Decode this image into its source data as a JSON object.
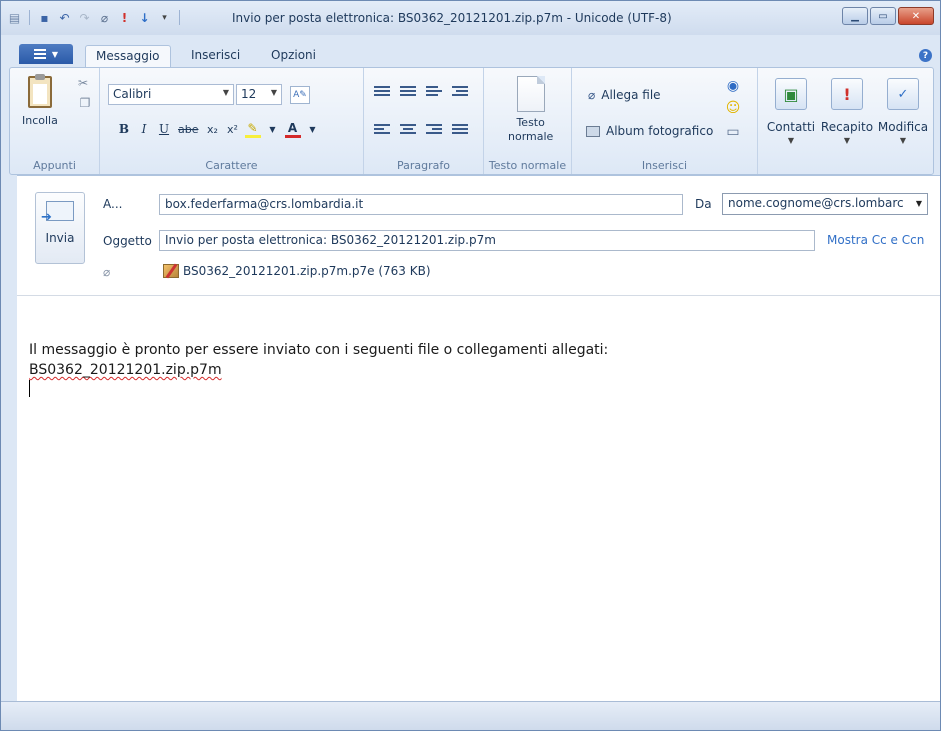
{
  "window": {
    "title": "Invio per posta elettronica: BS0362_20121201.zip.p7m - Unicode (UTF-8)"
  },
  "quick_access": {
    "icons": [
      "new-icon",
      "save-icon",
      "undo-icon",
      "redo-icon",
      "attach-icon",
      "high-importance-icon",
      "low-importance-icon",
      "customize-icon"
    ]
  },
  "tabs": [
    {
      "label": "Messaggio",
      "active": true
    },
    {
      "label": "Inserisci",
      "active": false
    },
    {
      "label": "Opzioni",
      "active": false
    }
  ],
  "ribbon": {
    "appunti": {
      "label": "Appunti",
      "paste_label": "Incolla"
    },
    "carattere": {
      "label": "Carattere",
      "font_name": "Calibri",
      "font_size": "12",
      "bold": "B",
      "italic": "I",
      "underline": "U",
      "strike": "abe",
      "subscript": "x₂",
      "superscript": "x²",
      "font_color": "A"
    },
    "paragrafo": {
      "label": "Paragrafo"
    },
    "testo_normale": {
      "label": "Testo normale",
      "button_line1": "Testo",
      "button_line2": "normale"
    },
    "inserisci": {
      "label": "Inserisci",
      "attach_file": "Allega file",
      "photo_album": "Album fotografico"
    },
    "actions": [
      {
        "label": "Contatti",
        "icon": "contacts-icon"
      },
      {
        "label": "Recapito",
        "icon": "priority-icon"
      },
      {
        "label": "Modifica",
        "icon": "spelling-icon"
      }
    ]
  },
  "header": {
    "send_label": "Invia",
    "to_label": "A...",
    "to_value": "box.federfarma@crs.lombardia.it",
    "from_label": "Da",
    "from_value": "nome.cognome@crs.lombarc",
    "subject_label": "Oggetto",
    "subject_value": "Invio per posta elettronica: BS0362_20121201.zip.p7m",
    "cc_link": "Mostra Cc e Ccn",
    "attachment": "BS0362_20121201.zip.p7m.p7e (763 KB)"
  },
  "body": {
    "line1": "Il messaggio è pronto per essere inviato con i seguenti file o collegamenti allegati:",
    "line2": "BS0362_20121201.zip.p7m"
  },
  "colors": {
    "accent": "#3270c7",
    "title_text": "#1e395b",
    "close_button": "#c9462c"
  }
}
